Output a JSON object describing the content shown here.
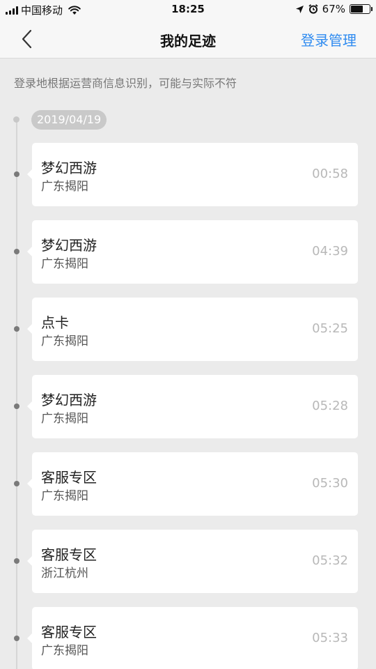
{
  "status_bar": {
    "carrier": "中国移动",
    "time": "18:25",
    "battery_percent": "67%",
    "battery_level": 0.67,
    "icons": [
      "signal-icon",
      "wifi-icon",
      "location-arrow-icon",
      "alarm-icon",
      "battery-icon"
    ]
  },
  "nav": {
    "title": "我的足迹",
    "action_label": "登录管理",
    "back_icon": "chevron-left-icon",
    "accent_color": "#2f8bf0"
  },
  "notice": "登录地根据运营商信息识别，可能与实际不符",
  "timeline": {
    "date": "2019/04/19",
    "entries": [
      {
        "title": "梦幻西游",
        "location": "广东揭阳",
        "time": "00:58"
      },
      {
        "title": "梦幻西游",
        "location": "广东揭阳",
        "time": "04:39"
      },
      {
        "title": "点卡",
        "location": "广东揭阳",
        "time": "05:25"
      },
      {
        "title": "梦幻西游",
        "location": "广东揭阳",
        "time": "05:28"
      },
      {
        "title": "客服专区",
        "location": "广东揭阳",
        "time": "05:30"
      },
      {
        "title": "客服专区",
        "location": "浙江杭州",
        "time": "05:32"
      },
      {
        "title": "客服专区",
        "location": "广东揭阳",
        "time": "05:33"
      }
    ]
  }
}
